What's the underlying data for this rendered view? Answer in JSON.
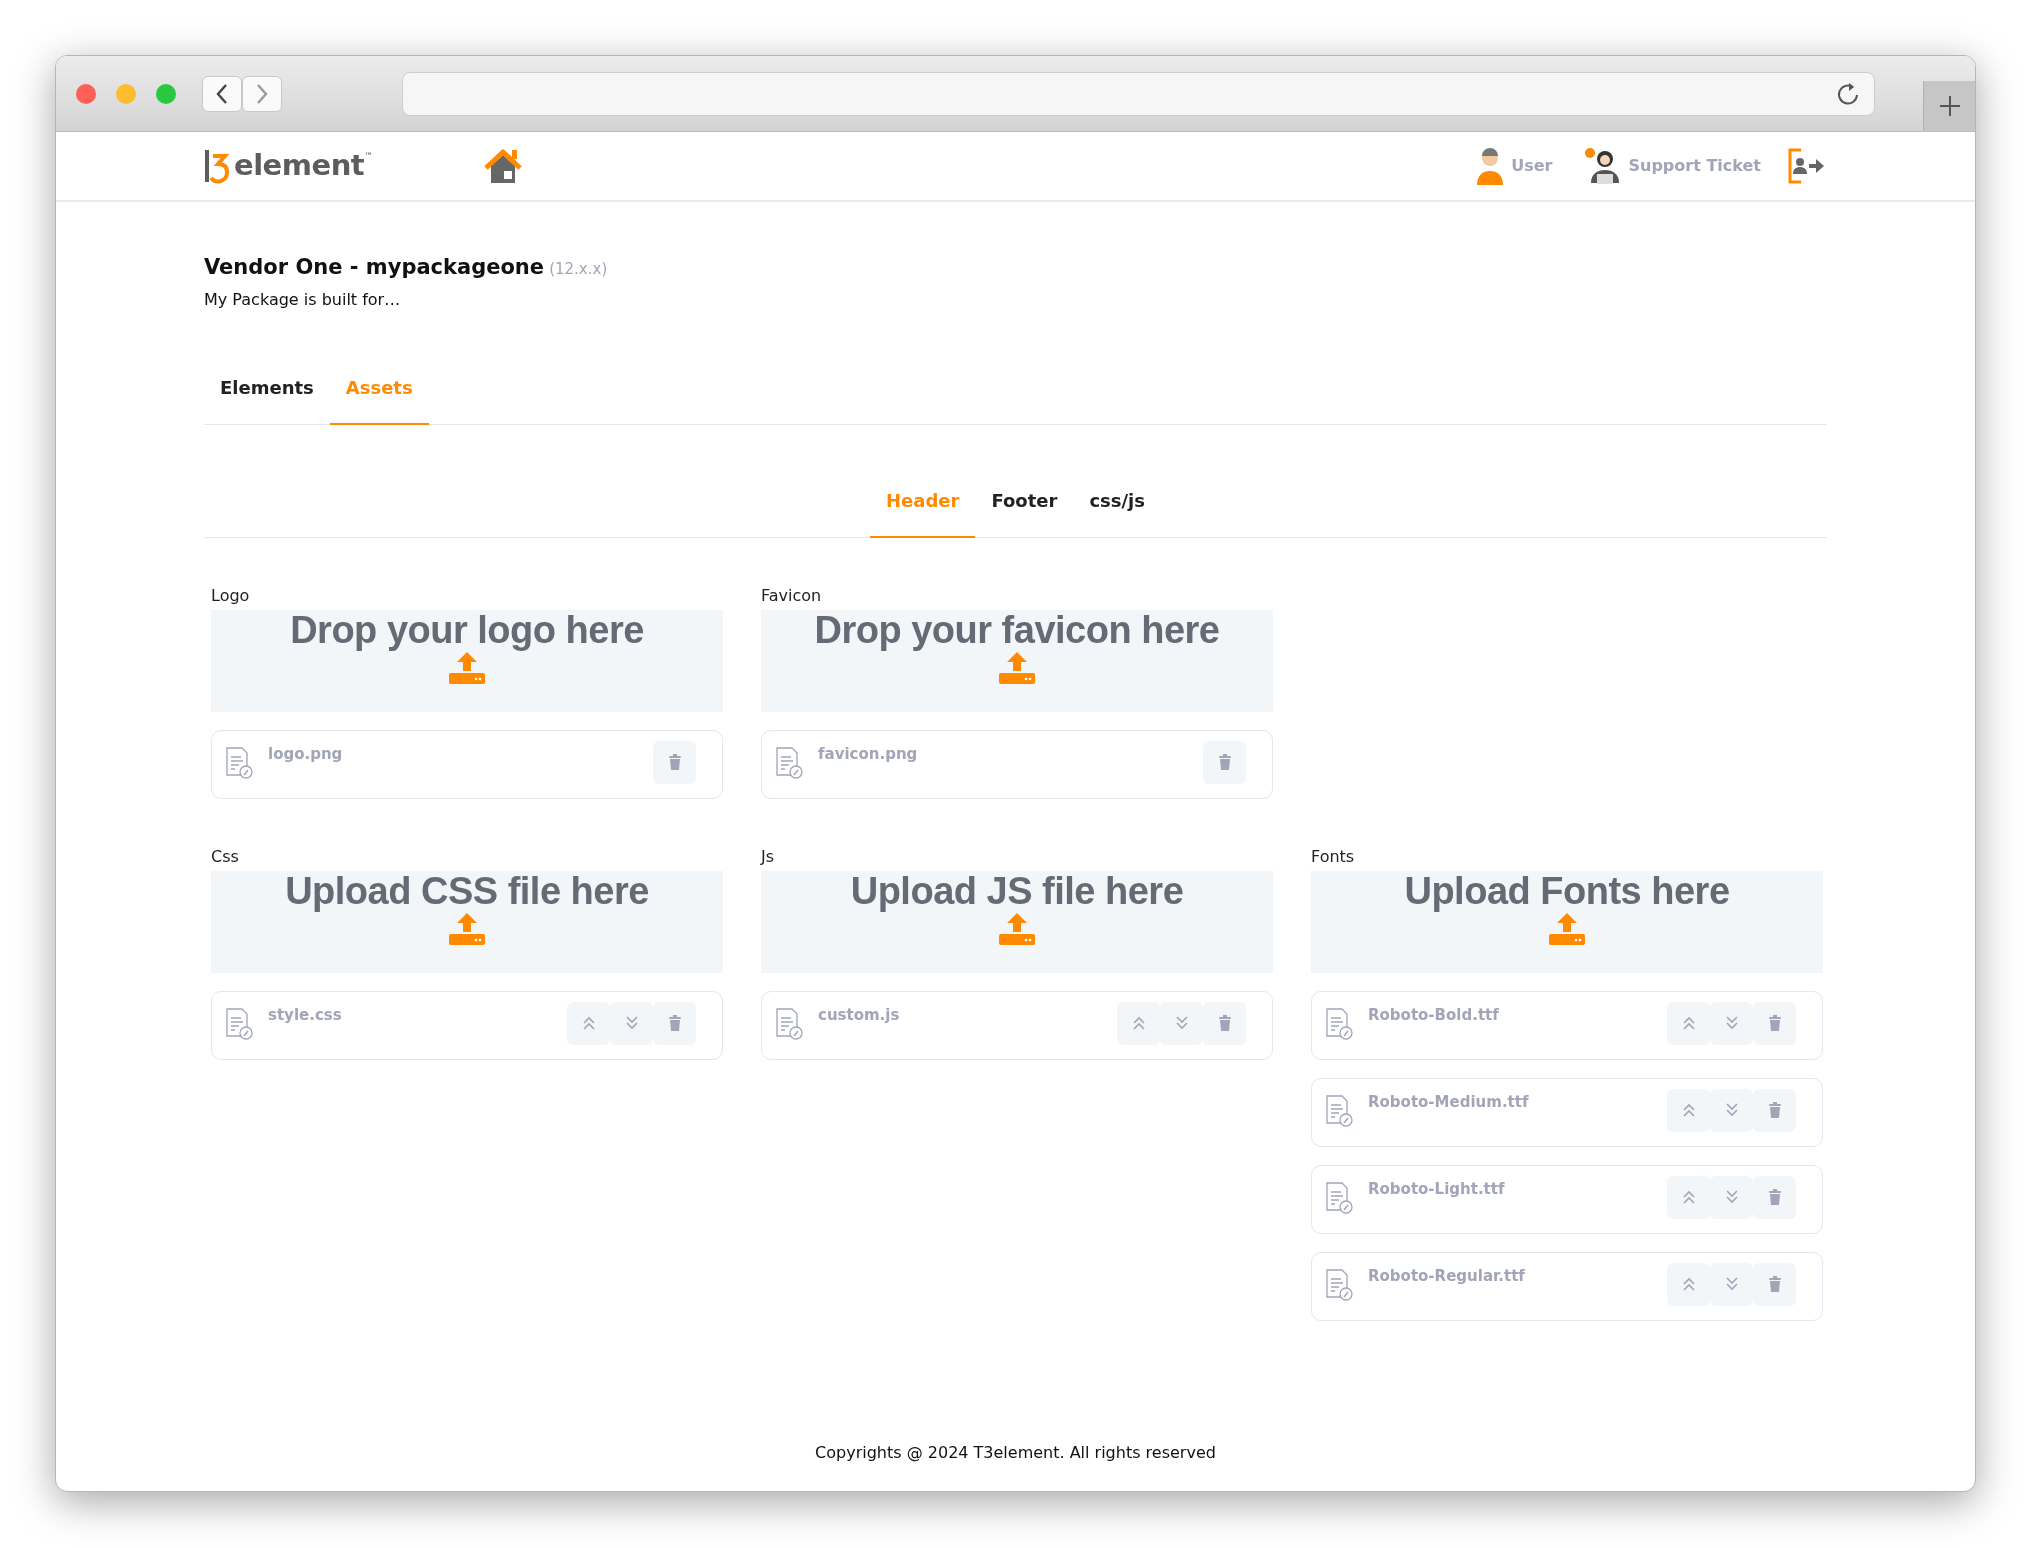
{
  "navbar": {
    "logo": {
      "text": "element",
      "trademark": "™"
    },
    "links": [
      {
        "label": "User",
        "kind": "user"
      },
      {
        "label": "Support Ticket",
        "kind": "support"
      }
    ]
  },
  "package": {
    "title": "Vendor One - mypackageone",
    "version": "(12.x.x)",
    "description": "My Package is built for…"
  },
  "tabs": [
    {
      "label": "Elements",
      "selected": false
    },
    {
      "label": "Assets",
      "selected": true
    }
  ],
  "subtabs": [
    {
      "label": "Header",
      "selected": true
    },
    {
      "label": "Footer",
      "selected": false
    },
    {
      "label": "css/js",
      "selected": false
    }
  ],
  "rows": [
    [
      {
        "label": "Logo",
        "dropzone": "Drop your logo here",
        "files": [
          {
            "name": "logo.png",
            "kind": "single"
          }
        ]
      },
      {
        "label": "Favicon",
        "dropzone": "Drop your favicon here",
        "files": [
          {
            "name": "favicon.png",
            "kind": "single"
          }
        ]
      }
    ],
    [
      {
        "label": "Css",
        "dropzone": "Upload CSS file here",
        "files": [
          {
            "name": "style.css",
            "kind": "ordered"
          }
        ]
      },
      {
        "label": "Js",
        "dropzone": "Upload JS file here",
        "files": [
          {
            "name": "custom.js",
            "kind": "ordered"
          }
        ]
      },
      {
        "label": "Fonts",
        "dropzone": "Upload Fonts  here",
        "files": [
          {
            "name": "Roboto-Bold.ttf",
            "kind": "ordered"
          },
          {
            "name": "Roboto-Medium.ttf",
            "kind": "ordered"
          },
          {
            "name": "Roboto-Light.ttf",
            "kind": "ordered"
          },
          {
            "name": "Roboto-Regular.ttf",
            "kind": "ordered"
          }
        ]
      }
    ]
  ],
  "footer": "Copyrights @ 2024 T3element. All rights reserved"
}
